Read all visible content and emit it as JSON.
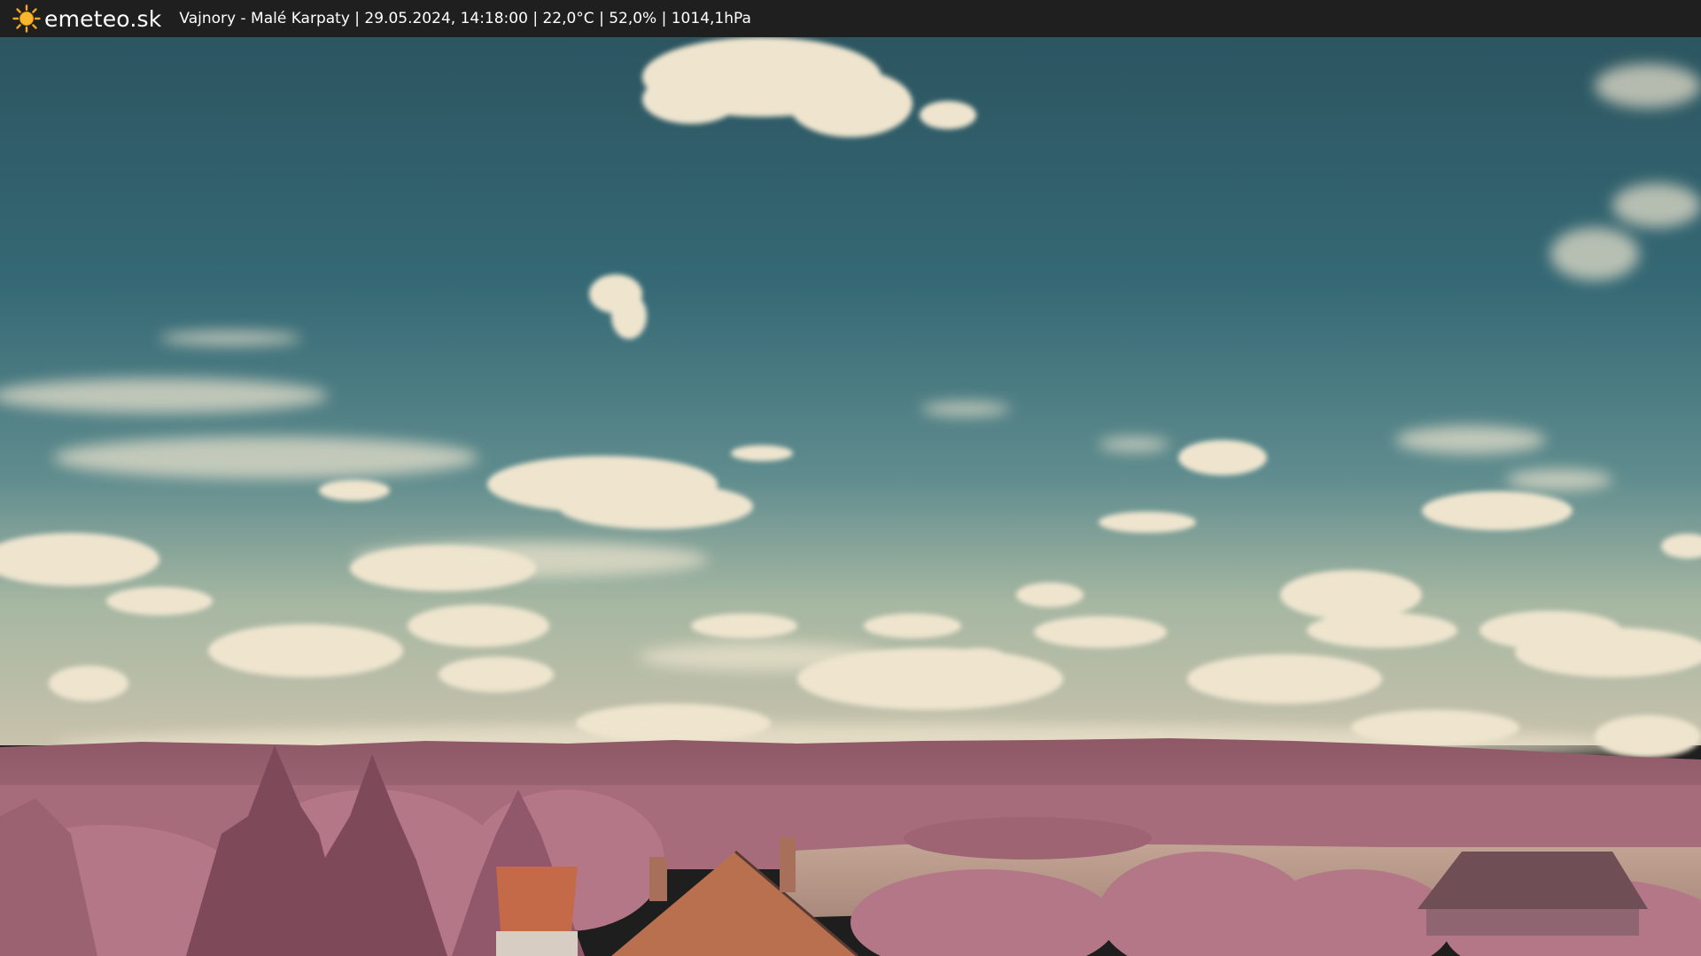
{
  "header": {
    "brand": "emeteo.sk",
    "logo_icon": "sun-icon",
    "caption": "Vajnory - Malé Karpaty | 29.05.2024, 14:18:00 | 22,0°C | 52,0% | 1014,1hPa"
  },
  "colors": {
    "bar_bg": "#1f1f1f",
    "sun": "#f5a623",
    "sky_top": "#2e5b66",
    "sky_horizon": "#9fb4a4",
    "cloud": "#efe6d0",
    "hills": "#9c6472",
    "foliage": "#b27585",
    "roof": "#c06b4d",
    "field": "#b99a8a"
  }
}
